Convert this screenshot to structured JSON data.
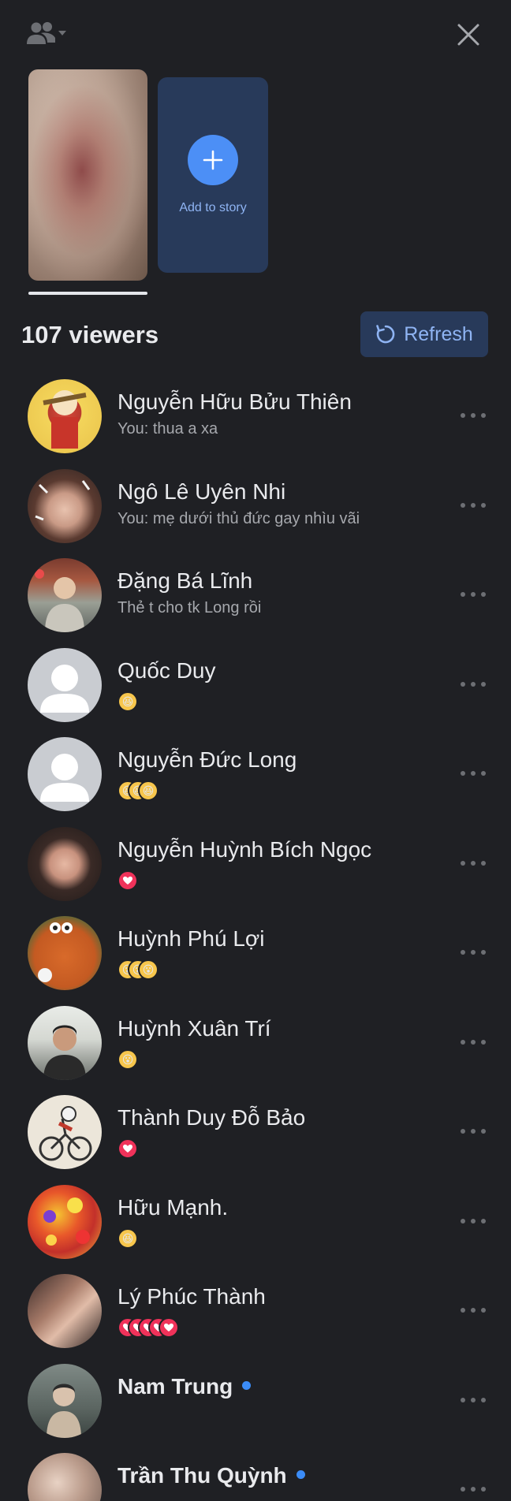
{
  "story": {
    "add_label": "Add to story"
  },
  "header": {
    "viewers_count": "107 viewers",
    "refresh_label": "Refresh"
  },
  "colors": {
    "background": "#1f2024",
    "accent_blue": "#4c8ff6",
    "button_bg": "#283a5a",
    "love": "#f0325a",
    "haha": "#f7c64c"
  },
  "viewers": [
    {
      "name": "Nguyễn Hữu Bửu Thiên",
      "subtitle": "You: thua a xa"
    },
    {
      "name": "Ngô Lê Uyên Nhi",
      "subtitle": "You: mẹ dưới thủ đức gay nhìu vãi"
    },
    {
      "name": "Đặng Bá Lĩnh",
      "subtitle": "Thẻ t cho tk Long rồi"
    },
    {
      "name": "Quốc Duy",
      "reactions": [
        "haha"
      ]
    },
    {
      "name": "Nguyễn Đức Long",
      "reactions": [
        "haha",
        "haha",
        "haha"
      ]
    },
    {
      "name": "Nguyễn Huỳnh Bích Ngọc",
      "reactions": [
        "love"
      ]
    },
    {
      "name": "Huỳnh Phú Lợi",
      "reactions": [
        "wow",
        "wow",
        "wow"
      ]
    },
    {
      "name": "Huỳnh Xuân Trí",
      "reactions": [
        "wow"
      ]
    },
    {
      "name": "Thành Duy Đỗ Bảo",
      "reactions": [
        "love"
      ]
    },
    {
      "name": "Hữu Mạnh.",
      "reactions": [
        "haha"
      ]
    },
    {
      "name": "Lý Phúc Thành",
      "reactions": [
        "love",
        "love",
        "love",
        "love",
        "love"
      ]
    },
    {
      "name": "Nam Trung",
      "online": true
    },
    {
      "name": "Trần Thu Quỳnh",
      "online": true
    }
  ]
}
